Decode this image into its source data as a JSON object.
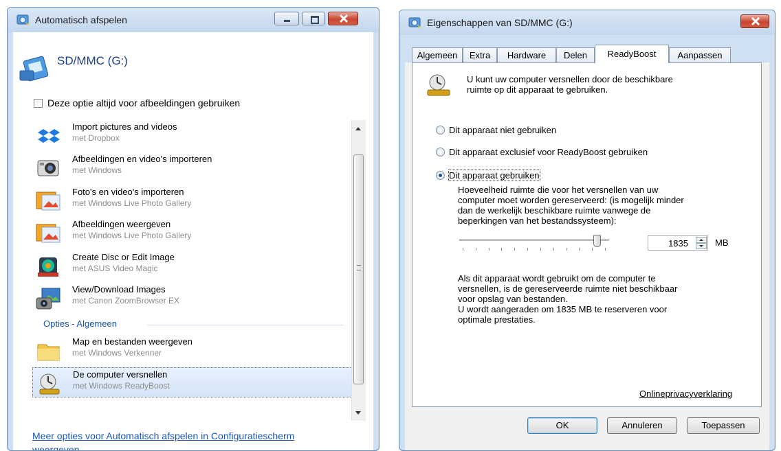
{
  "autoplay": {
    "title": "Automatisch afspelen",
    "device": "SD/MMC (G:)",
    "always_option": "Deze optie altijd voor afbeeldingen gebruiken",
    "items": [
      {
        "label": "Import pictures and videos",
        "sub": "met Dropbox",
        "icon": "dropbox-icon"
      },
      {
        "label": "Afbeeldingen en video's importeren",
        "sub": "met Windows",
        "icon": "camera-icon"
      },
      {
        "label": "Foto's en video's importeren",
        "sub": "met Windows Live Photo Gallery",
        "icon": "photo-gallery-icon"
      },
      {
        "label": "Afbeeldingen weergeven",
        "sub": "met Windows Live Photo Gallery",
        "icon": "photo-gallery-icon"
      },
      {
        "label": "Create Disc or Edit Image",
        "sub": "met ASUS Video Magic",
        "icon": "video-magic-icon"
      },
      {
        "label": "View/Download Images",
        "sub": "met Canon ZoomBrowser EX",
        "icon": "zoombrowser-icon"
      }
    ],
    "section": "Opties - Algemeen",
    "general_items": [
      {
        "label": "Map en bestanden weergeven",
        "sub": "met Windows Verkenner",
        "icon": "folder-icon"
      },
      {
        "label": "De computer versnellen",
        "sub": "met Windows ReadyBoost",
        "icon": "readyboost-icon"
      }
    ],
    "more_link_line1": "Meer opties voor Automatisch afspelen in Configuratiescherm",
    "more_link_line2": "weergeven"
  },
  "properties": {
    "title": "Eigenschappen van SD/MMC (G:)",
    "tabs": [
      "Algemeen",
      "Extra",
      "Hardware",
      "Delen",
      "ReadyBoost",
      "Aanpassen"
    ],
    "active_tab": "ReadyBoost",
    "intro_line1": "U kunt uw computer versnellen door de beschikbare",
    "intro_line2": "ruimte op dit apparaat te gebruiken.",
    "radio_not_use": "Dit apparaat niet gebruiken",
    "radio_exclusive": "Dit apparaat exclusief voor ReadyBoost gebruiken",
    "radio_use": "Dit apparaat gebruiken",
    "selected_radio": "Dit apparaat gebruiken",
    "space_line1": "Hoeveelheid ruimte die voor het versnellen van uw",
    "space_line2": "computer moet worden gereserveerd: (is mogelijk minder",
    "space_line3": "dan de werkelijk beschikbare ruimte vanwege de",
    "space_line4": "beperkingen van het bestandssysteem):",
    "slider_value_fraction": 0.94,
    "spin_value": "1835",
    "unit": "MB",
    "note_line1": "Als dit apparaat wordt gebruikt om de computer te",
    "note_line2": "versnellen, is de gereserveerde ruimte niet beschikbaar",
    "note_line3": "voor opslag van bestanden.",
    "note_line4": "U wordt aangeraden om 1835 MB te reserveren voor",
    "note_line5": "optimale prestaties.",
    "privacy_link": "Onlineprivacyverklaring",
    "ok": "OK",
    "cancel": "Annuleren",
    "apply": "Toepassen"
  }
}
